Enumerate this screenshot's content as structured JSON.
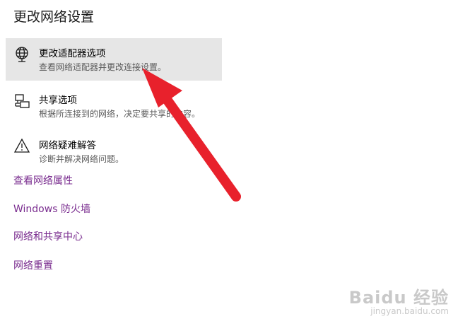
{
  "page": {
    "title": "更改网络设置"
  },
  "options": [
    {
      "name": "更改适配器选项",
      "desc": "查看网络适配器并更改连接设置。",
      "icon": "globe-network-icon"
    },
    {
      "name": "共享选项",
      "desc": "根据所连接到的网络，决定要共享的内容。",
      "icon": "sharing-icon"
    },
    {
      "name": "网络疑难解答",
      "desc": "诊断并解决网络问题。",
      "icon": "warning-triangle-icon"
    }
  ],
  "links": [
    "查看网络属性",
    "Windows 防火墙",
    "网络和共享中心",
    "网络重置"
  ],
  "annotation": {
    "arrow_color": "#e8212c"
  },
  "watermark": {
    "brand": "Baidu 经验",
    "url": "jingyan.baidu.com"
  },
  "colors": {
    "link": "#7a2d8f",
    "hover_bg": "#e6e6e6"
  }
}
